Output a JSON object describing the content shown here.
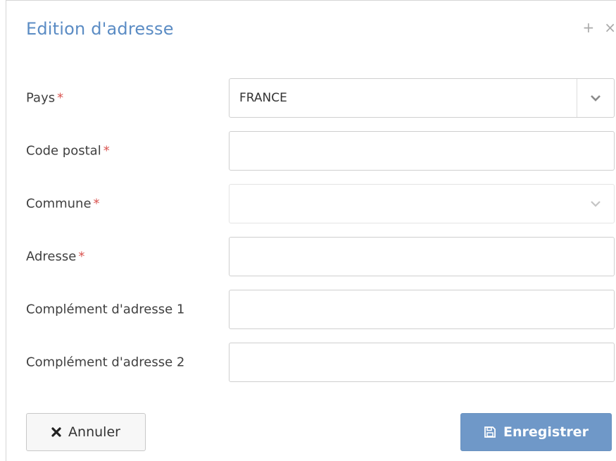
{
  "dialog": {
    "title": "Edition d'adresse",
    "actions": {
      "maximize_glyph": "+",
      "close_glyph": "×"
    }
  },
  "form": {
    "pays": {
      "label": "Pays",
      "required_mark": "*",
      "value": "FRANCE"
    },
    "code_postal": {
      "label": "Code postal",
      "required_mark": "*",
      "value": ""
    },
    "commune": {
      "label": "Commune",
      "required_mark": "*",
      "value": ""
    },
    "adresse": {
      "label": "Adresse",
      "required_mark": "*",
      "value": ""
    },
    "complement_1": {
      "label": "Complément d'adresse 1",
      "value": ""
    },
    "complement_2": {
      "label": "Complément d'adresse 2",
      "value": ""
    }
  },
  "buttons": {
    "cancel_label": "Annuler",
    "save_label": "Enregistrer"
  },
  "icons": {
    "cancel": "times-icon",
    "save": "floppy-disk-icon",
    "dropdown": "chevron-down-icon"
  },
  "colors": {
    "title": "#5b8cc4",
    "required": "#d9534f",
    "primary_button": "#6f98c8"
  }
}
